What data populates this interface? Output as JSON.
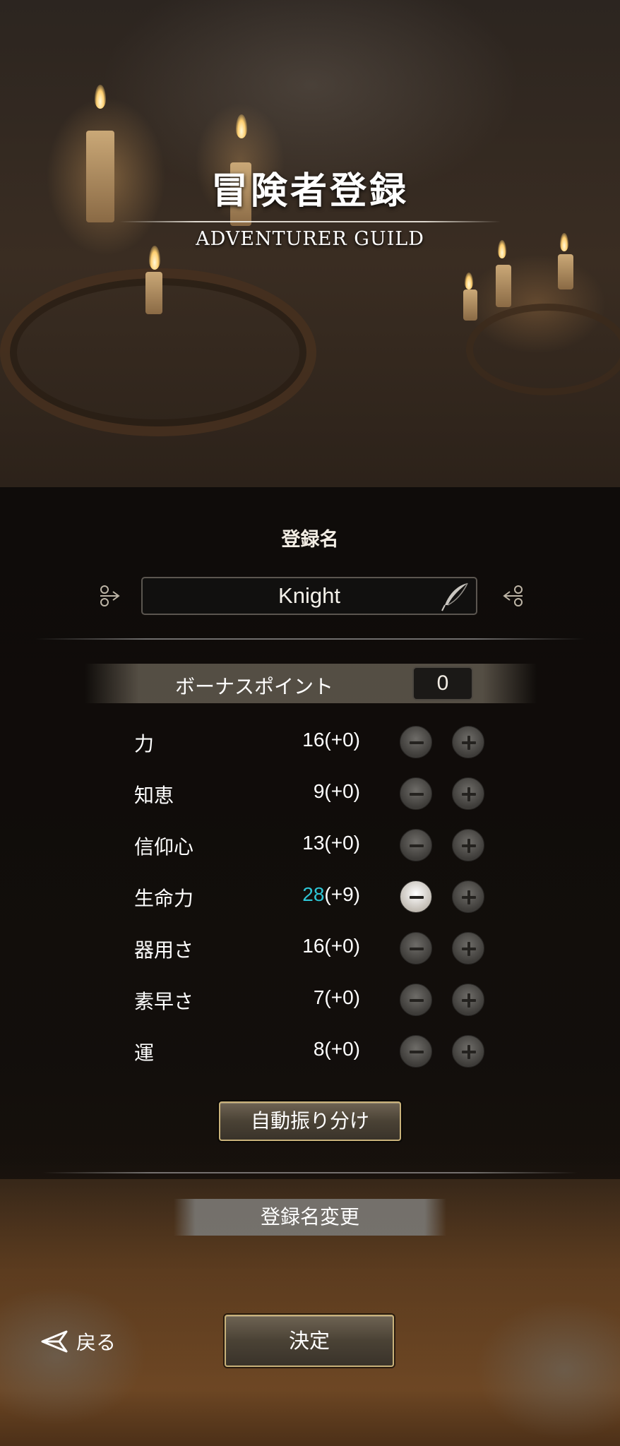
{
  "header": {
    "title": "冒険者登録",
    "subtitle": "ADVENTURER GUILD"
  },
  "name_section": {
    "label": "登録名",
    "value": "Knight",
    "edit_icon": "quill-pen-icon"
  },
  "bonus": {
    "label": "ボーナスポイント",
    "value": "0"
  },
  "stats": [
    {
      "name": "力",
      "current": "16",
      "bonus": "(+0)",
      "highlighted": false,
      "minus_active": false
    },
    {
      "name": "知恵",
      "current": "9",
      "bonus": "(+0)",
      "highlighted": false,
      "minus_active": false
    },
    {
      "name": "信仰心",
      "current": "13",
      "bonus": "(+0)",
      "highlighted": false,
      "minus_active": false
    },
    {
      "name": "生命力",
      "current": "28",
      "bonus": "(+9)",
      "highlighted": true,
      "minus_active": true
    },
    {
      "name": "器用さ",
      "current": "16",
      "bonus": "(+0)",
      "highlighted": false,
      "minus_active": false
    },
    {
      "name": "素早さ",
      "current": "7",
      "bonus": "(+0)",
      "highlighted": false,
      "minus_active": false
    },
    {
      "name": "運",
      "current": "8",
      "bonus": "(+0)",
      "highlighted": false,
      "minus_active": false
    }
  ],
  "buttons": {
    "auto_assign": "自動振り分け",
    "rename": "登録名変更",
    "confirm": "決定",
    "back": "戻る"
  },
  "colors": {
    "highlight_value": "#2ec6d6",
    "button_border_gold": "#c9b27a"
  }
}
